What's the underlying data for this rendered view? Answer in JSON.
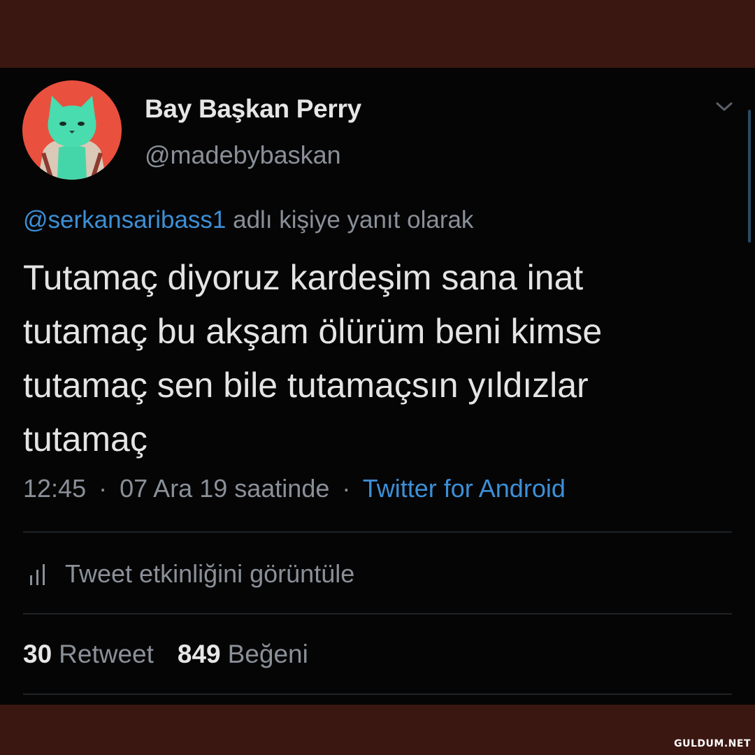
{
  "author": {
    "display_name": "Bay Başkan Perry",
    "handle": "@madebybaskan",
    "avatar_icon": "cat-avatar-icon"
  },
  "reply": {
    "mention": "@serkansaribass1",
    "suffix": "adlı kişiye yanıt olarak"
  },
  "tweet": {
    "lines": [
      "Tutamaç diyoruz kardeşim sana inat",
      "tutamaç bu akşam ölürüm beni kimse",
      "tutamaç sen bile tutamaçsın yıldızlar",
      "tutamaç"
    ]
  },
  "meta": {
    "time": "12:45",
    "date": "07 Ara 19 saatinde",
    "separator": "·",
    "source": "Twitter for Android"
  },
  "activity": {
    "label": "Tweet etkinliğini görüntüle",
    "icon": "bar-chart-icon"
  },
  "stats": {
    "retweet_count": "30",
    "retweet_label": "Retweet",
    "like_count": "849",
    "like_label": "Beğeni"
  },
  "watermark": "GULDUM.NET",
  "colors": {
    "background": "#050505",
    "frame": "#3b1712",
    "accent_blue": "#3d8fd6",
    "text_primary": "#e4e4e4",
    "text_secondary": "#8a9099"
  }
}
